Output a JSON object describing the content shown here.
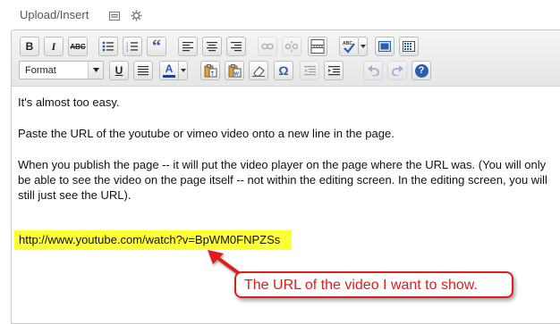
{
  "header": {
    "title": "Upload/Insert",
    "icons": [
      "media-icon",
      "gear-icon"
    ]
  },
  "toolbar": {
    "row1": [
      {
        "name": "bold-button",
        "label": "B"
      },
      {
        "name": "italic-button",
        "label": "I"
      },
      {
        "name": "strikethrough-button",
        "label": "ABC"
      },
      {
        "name": "bullet-list-button",
        "icon": "bullet-list-icon"
      },
      {
        "name": "numbered-list-button",
        "icon": "numbered-list-icon"
      },
      {
        "name": "blockquote-button",
        "label": "“"
      },
      {
        "name": "align-left-button",
        "icon": "align-left-icon"
      },
      {
        "name": "align-center-button",
        "icon": "align-center-icon"
      },
      {
        "name": "align-right-button",
        "icon": "align-right-icon"
      },
      {
        "name": "insert-link-button",
        "icon": "link-icon",
        "disabled": true
      },
      {
        "name": "unlink-button",
        "icon": "unlink-icon",
        "disabled": true
      },
      {
        "name": "insert-more-button",
        "icon": "more-tag-icon"
      },
      {
        "name": "spellcheck-button",
        "label": "ABC",
        "icon": "spellcheck-icon"
      },
      {
        "name": "fullscreen-button",
        "icon": "fullscreen-icon"
      },
      {
        "name": "kitchen-sink-button",
        "icon": "kitchen-sink-icon"
      }
    ],
    "format_select": {
      "value": "Format"
    },
    "row2": [
      {
        "name": "underline-button",
        "label": "U"
      },
      {
        "name": "justify-button",
        "icon": "justify-icon"
      },
      {
        "name": "text-color-button",
        "label": "A"
      },
      {
        "name": "paste-text-button",
        "icon": "paste-text-icon"
      },
      {
        "name": "paste-word-button",
        "icon": "paste-word-icon"
      },
      {
        "name": "remove-format-button",
        "icon": "eraser-icon"
      },
      {
        "name": "special-char-button",
        "label": "Ω"
      },
      {
        "name": "outdent-button",
        "icon": "outdent-icon",
        "disabled": true
      },
      {
        "name": "indent-button",
        "icon": "indent-icon"
      },
      {
        "name": "undo-button",
        "icon": "undo-icon",
        "disabled": true
      },
      {
        "name": "redo-button",
        "icon": "redo-icon",
        "disabled": true
      },
      {
        "name": "help-button",
        "label": "?"
      }
    ],
    "accent": "#2a5db0"
  },
  "content": {
    "paragraphs": [
      "It's almost too easy.",
      "Paste the URL of the youtube or vimeo video onto a new line in the page.",
      "When you publish the page -- it will put the video player on the page where the URL was. (You will only be able to see the video on the page itself -- not within the editing screen.  In the editing screen, you will still just see the URL)."
    ],
    "url": "http://www.youtube.com/watch?v=BpWM0FNPZSs",
    "highlight_color": "#ffff33"
  },
  "callout": {
    "text": "The URL of the video I want to show.",
    "color": "#e01c1c"
  }
}
